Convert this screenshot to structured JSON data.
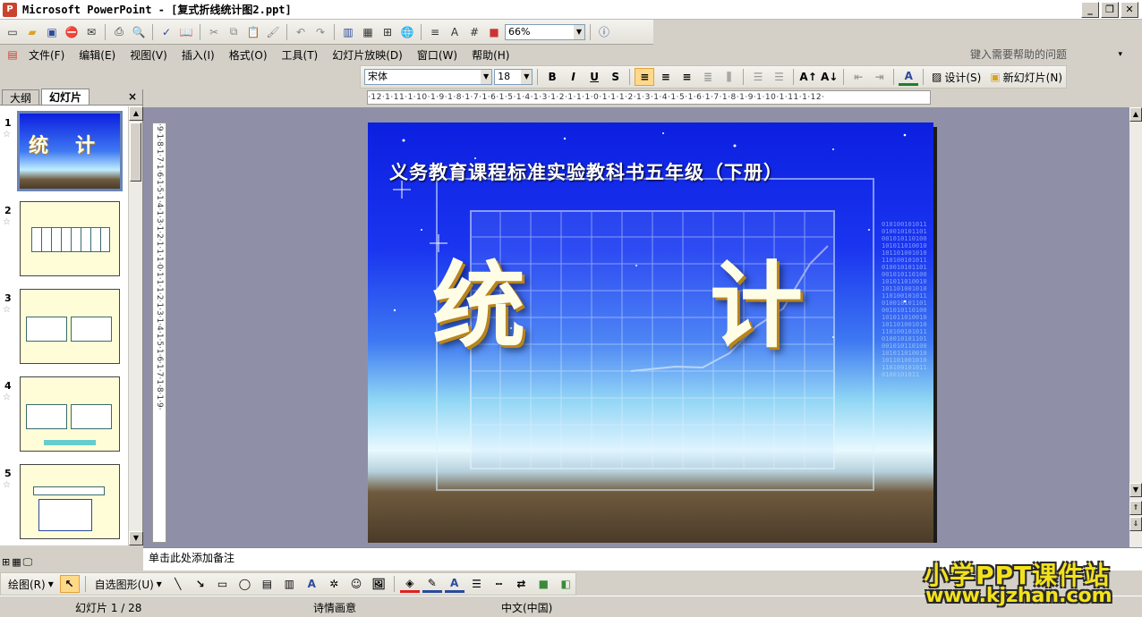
{
  "window": {
    "title": "Microsoft PowerPoint - [复式折线统计图2.ppt]",
    "app_icon": "P",
    "minimize": "_",
    "restore": "❐",
    "close": "✕"
  },
  "standard_toolbar": {
    "zoom": "66%"
  },
  "menubar": {
    "items": [
      "文件(F)",
      "编辑(E)",
      "视图(V)",
      "插入(I)",
      "格式(O)",
      "工具(T)",
      "幻灯片放映(D)",
      "窗口(W)",
      "帮助(H)"
    ],
    "help_placeholder": "键入需要帮助的问题",
    "help_dropdown": "▾"
  },
  "formatting_toolbar": {
    "font": "宋体",
    "font_size": "18",
    "bold": "B",
    "italic": "I",
    "underline": "U",
    "shadow": "S",
    "font_color_glyph": "A",
    "design_label": "设计(S)",
    "new_slide_label": "新幻灯片(N)"
  },
  "ruler": {
    "horizontal": "·12·1·11·1·10·1·9·1·8·1·7·1·6·1·5·1·4·1·3·1·2·1·1·1·0·1·1·1·2·1·3·1·4·1·5·1·6·1·7·1·8·1·9·1·10·1·11·1·12·",
    "vertical": "·9·1·8·1·7·1·6·1·5·1·4·1·3·1·2·1·1·1·0·1·1·1·2·1·3·1·4·1·5·1·6·1·7·1·8·1·9·"
  },
  "left_pane": {
    "tab_outline": "大纲",
    "tab_slides": "幻灯片",
    "close": "×",
    "thumbnails": [
      {
        "num": "1",
        "star": "☆"
      },
      {
        "num": "2",
        "star": "☆"
      },
      {
        "num": "3",
        "star": "☆"
      },
      {
        "num": "4",
        "star": "☆"
      },
      {
        "num": "5",
        "star": "☆"
      }
    ]
  },
  "slide": {
    "subtitle": "义务教育课程标准实验教科书五年级（下册）",
    "char1": "统",
    "char2": "计",
    "binary": "0101001010110100101011010010101101001010110100101011010010101101001010110100101011010010101101001010110100101011010010101101001010110100101011010010101101001010110100101011010010101101001010110100101011010010101101001010110100101011010010101101001010110100101011"
  },
  "notes": {
    "placeholder": "单击此处添加备注"
  },
  "drawing_toolbar": {
    "draw_label": "绘图(R)",
    "autoshapes_label": "自选图形(U)"
  },
  "statusbar": {
    "slide_indicator": "幻灯片 1 / 28",
    "design_name": "诗情画意",
    "language": "中文(中国)"
  },
  "watermark": {
    "line1": "小学PPT课件站",
    "line2": "www.kjzhan.com"
  }
}
